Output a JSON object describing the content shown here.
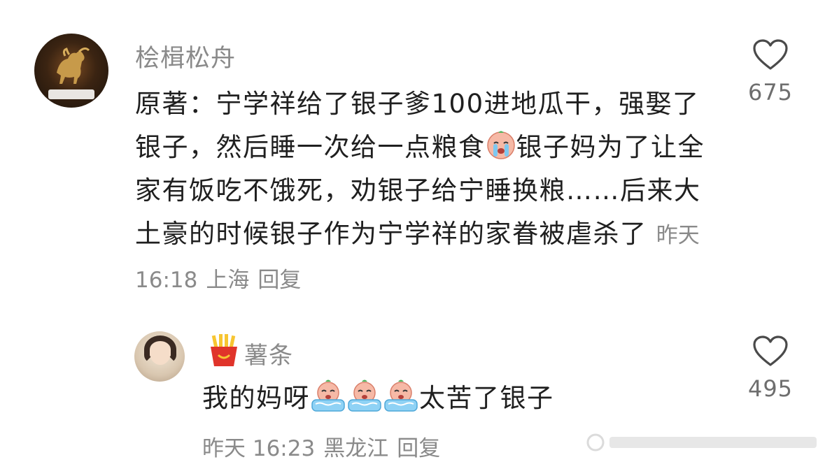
{
  "comment": {
    "username": "桧楫松舟",
    "text_parts": [
      "原著：宁学祥给了银子爹100进地瓜干，强娶了银子，然后睡一次给一点粮食",
      "银子妈为了让全家有饭吃不饿死，劝银子给宁睡换粮……后来大土豪的时候银子作为宁学祥的家眷被虐杀了"
    ],
    "emoji": "crying-face-emoji",
    "time": "昨天 16:18",
    "location": "上海",
    "reply_label": "回复",
    "likes": "675"
  },
  "reply": {
    "badge_icon": "fries-icon",
    "username": "薯条",
    "text_before": "我的妈呀",
    "emoji_count": 3,
    "text_after": "太苦了银子",
    "time": "昨天 16:23",
    "location": "黑龙江",
    "reply_label": "回复",
    "likes": "495"
  },
  "colors": {
    "meta": "#8a8a8a",
    "text": "#1f1f1f",
    "like_count": "#6e6e6e"
  }
}
